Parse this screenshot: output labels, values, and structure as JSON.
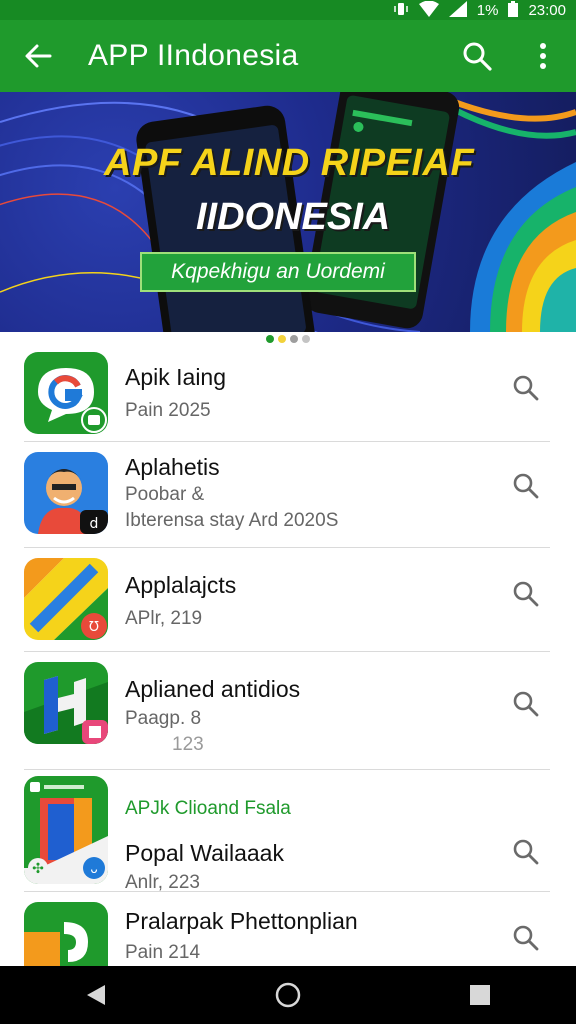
{
  "status_bar": {
    "battery_percent": "1%",
    "time": "23:00",
    "icons": [
      "vibrate-icon",
      "wifi-icon",
      "signal-icon",
      "battery-icon"
    ]
  },
  "app_bar": {
    "title": "APP IIndonesia",
    "background": "#1f9a2c",
    "icons": [
      "back-arrow-icon",
      "search-icon",
      "more-vert-icon"
    ]
  },
  "banner": {
    "headline_line1": "APF ALIND RIPEIAF",
    "headline_line2": "IIDONESIA",
    "tagline": "Kqpekhigu an Uordemi",
    "accent_yellow": "#f5d31a",
    "accent_green": "#22a23b"
  },
  "carousel": {
    "active_index": 0,
    "dot_count": 4,
    "dot_colors": [
      "#1f9a2c",
      "#f2d23b",
      "#9e9e9e",
      "#c4c4c4"
    ]
  },
  "apps": [
    {
      "name": "Apik Iaing",
      "meta_lines": [
        "Pain 2025"
      ],
      "icon": "g-chat-app-icon"
    },
    {
      "name": "Aplahetis",
      "meta_lines": [
        "Poobar &",
        "Ibterensa stay Ard 2020S"
      ],
      "icon": "character-app-icon"
    },
    {
      "name": "Applalajcts",
      "meta_lines": [
        "APlr, 219"
      ],
      "icon": "maps-app-icon"
    },
    {
      "name": "Aplianed antidios",
      "meta_lines": [
        "Paagp. 8",
        "123"
      ],
      "icon": "h-app-icon"
    },
    {
      "kicker": "APJk Clioand Fsala",
      "name": "Popal Wailaaak",
      "meta_lines": [
        "Anlr, 223"
      ],
      "icon": "book-app-icon"
    },
    {
      "name": "Pralarpak Phettonplian",
      "meta_lines": [
        "Pain 214"
      ],
      "icon": "green-orange-app-icon"
    }
  ],
  "nav_bar": {
    "icons": [
      "back-triangle-icon",
      "home-circle-icon",
      "recents-square-icon"
    ]
  }
}
